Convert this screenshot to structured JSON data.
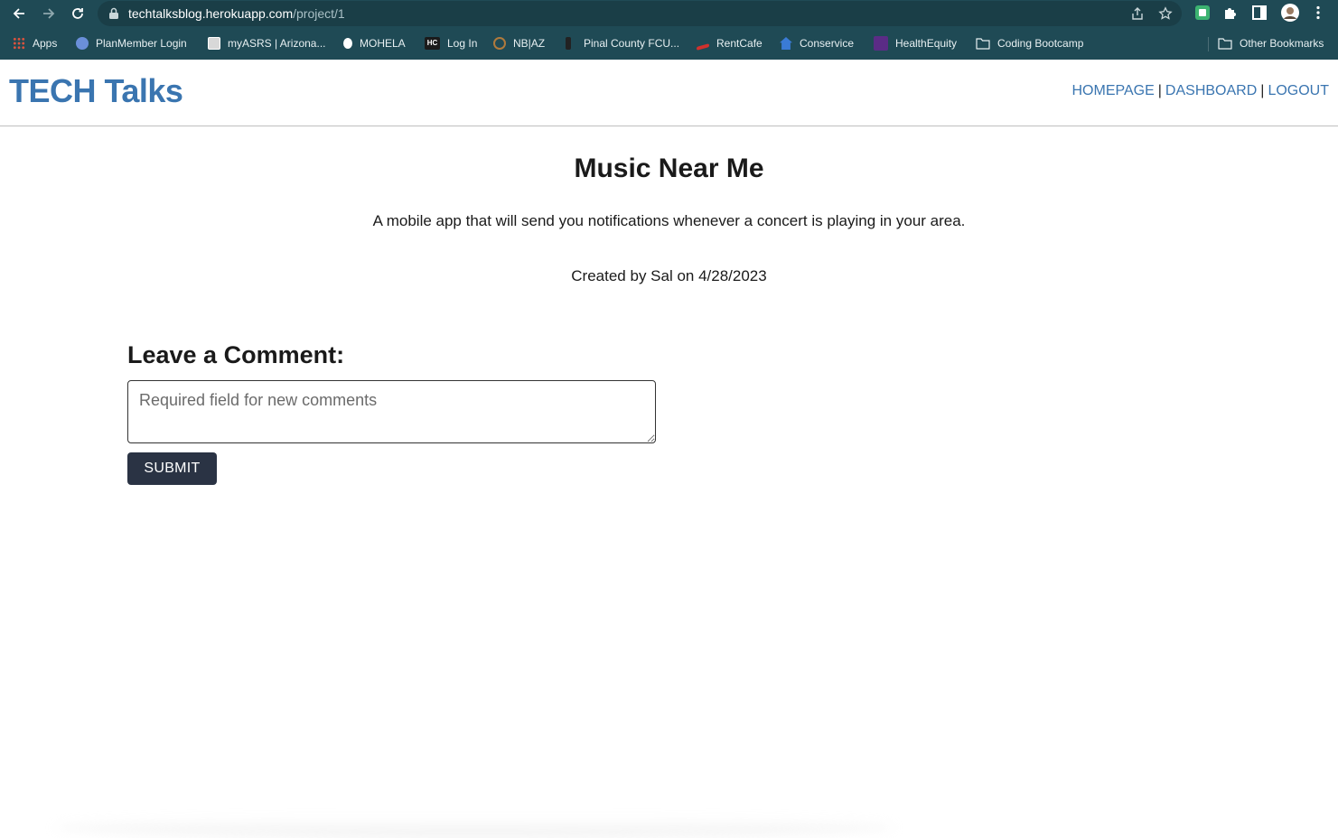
{
  "browser": {
    "url_host": "techtalksblog.herokuapp.com",
    "url_path": "/project/1",
    "bookmarks": [
      {
        "label": "Apps",
        "color": "#e0533d",
        "icon": "apps-grid-icon"
      },
      {
        "label": "PlanMember Login",
        "color": "#6a8fd9",
        "icon": "planmember-icon"
      },
      {
        "label": "myASRS | Arizona...",
        "color": "#d8d8d8",
        "icon": "asrs-icon"
      },
      {
        "label": "MOHELA",
        "color": "#ffffff",
        "icon": "mohela-icon"
      },
      {
        "label": "Log In",
        "color": "#1b1b1b",
        "icon": "hc-icon"
      },
      {
        "label": "NB|AZ",
        "color": "#b07a3c",
        "icon": "nbaz-icon"
      },
      {
        "label": "Pinal County FCU...",
        "color": "#222222",
        "icon": "cactus-icon"
      },
      {
        "label": "RentCafe",
        "color": "#d0312d",
        "icon": "rentcafe-icon"
      },
      {
        "label": "Conservice",
        "color": "#3a7bd5",
        "icon": "house-icon"
      },
      {
        "label": "HealthEquity",
        "color": "#5b2c86",
        "icon": "healthequity-icon"
      },
      {
        "label": "Coding Bootcamp",
        "color": "#e8f0f2",
        "icon": "folder-icon"
      }
    ],
    "other_bookmarks": "Other Bookmarks"
  },
  "header": {
    "logo": "TECH Talks",
    "nav": {
      "homepage": "HOMEPAGE",
      "dashboard": "DASHBOARD",
      "logout": "LOGOUT",
      "separator": "|"
    }
  },
  "post": {
    "title": "Music Near Me",
    "description": "A mobile app that will send you notifications whenever a concert is playing in your area.",
    "meta": "Created by Sal on 4/28/2023"
  },
  "comment": {
    "heading": "Leave a Comment:",
    "placeholder": "Required field for new comments",
    "submit_label": "SUBMIT"
  },
  "colors": {
    "chrome": "#1f4a55",
    "accent": "#3a75b0",
    "button": "#2a3344"
  }
}
